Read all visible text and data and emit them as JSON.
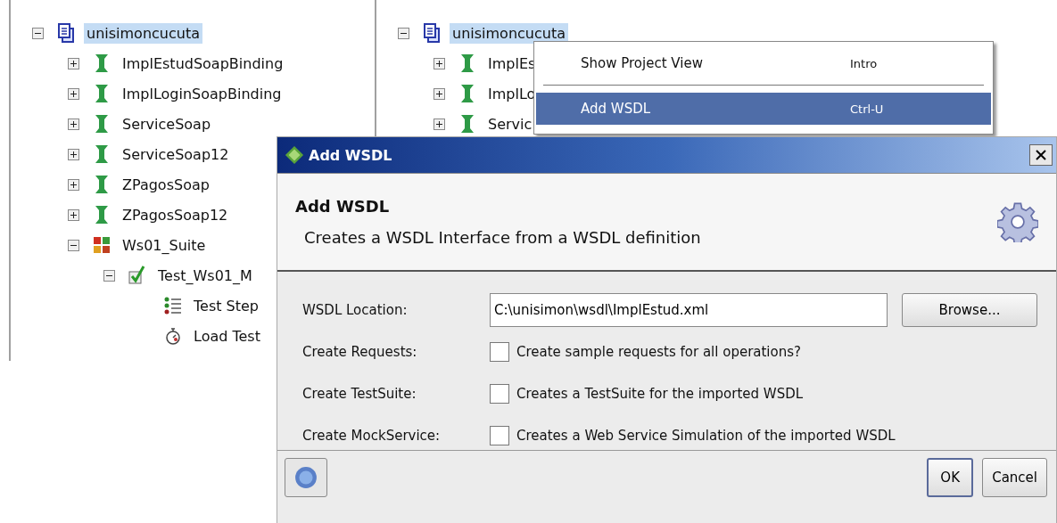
{
  "left_tree": {
    "root": {
      "kind": "project",
      "label": "unisimoncucuta",
      "selected": true,
      "expanded": true,
      "children": [
        {
          "kind": "interface",
          "label": "ImplEstudSoapBinding",
          "expanded": false
        },
        {
          "kind": "interface",
          "label": "ImplLoginSoapBinding",
          "expanded": false
        },
        {
          "kind": "interface",
          "label": "ServiceSoap",
          "expanded": false
        },
        {
          "kind": "interface",
          "label": "ServiceSoap12",
          "expanded": false
        },
        {
          "kind": "interface",
          "label": "ZPagosSoap",
          "expanded": false
        },
        {
          "kind": "interface",
          "label": "ZPagosSoap12",
          "expanded": false
        },
        {
          "kind": "suite",
          "label": "Ws01_Suite",
          "expanded": true,
          "children": [
            {
              "kind": "testcase",
              "label": "Test_Ws01_M",
              "expanded": true,
              "children": [
                {
                  "kind": "steps",
                  "label": "Test Step"
                },
                {
                  "kind": "loadtest",
                  "label": "Load Test"
                }
              ]
            }
          ]
        }
      ]
    }
  },
  "right_tree": {
    "root": {
      "kind": "project",
      "label": "unisimoncucuta",
      "selected": true,
      "expanded": true,
      "children": [
        {
          "kind": "interface",
          "label": "ImplEs",
          "expanded": false
        },
        {
          "kind": "interface",
          "label": "ImplLo",
          "expanded": false
        },
        {
          "kind": "interface",
          "label": "Servic",
          "expanded": false
        }
      ]
    }
  },
  "context_menu": {
    "items": [
      {
        "label": "Show Project View",
        "shortcut": "Intro",
        "selected": false
      },
      {
        "label": "Add WSDL",
        "shortcut": "Ctrl-U",
        "selected": true
      }
    ]
  },
  "dialog": {
    "title": "Add WSDL",
    "heading": "Add WSDL",
    "description": "Creates a WSDL Interface from a WSDL definition",
    "location": {
      "label": "WSDL Location:",
      "value": "C:\\unisimon\\wsdl\\ImplEstud.xml",
      "browse": "Browse..."
    },
    "options": [
      {
        "label": "Create Requests:",
        "text": "Create sample requests for all operations?",
        "checked": false
      },
      {
        "label": "Create TestSuite:",
        "text": "Creates a TestSuite for the imported WSDL",
        "checked": false
      },
      {
        "label": "Create MockService:",
        "text": "Creates a Web Service Simulation of the imported WSDL",
        "checked": false
      }
    ],
    "buttons": [
      "OK",
      "Cancel"
    ]
  }
}
